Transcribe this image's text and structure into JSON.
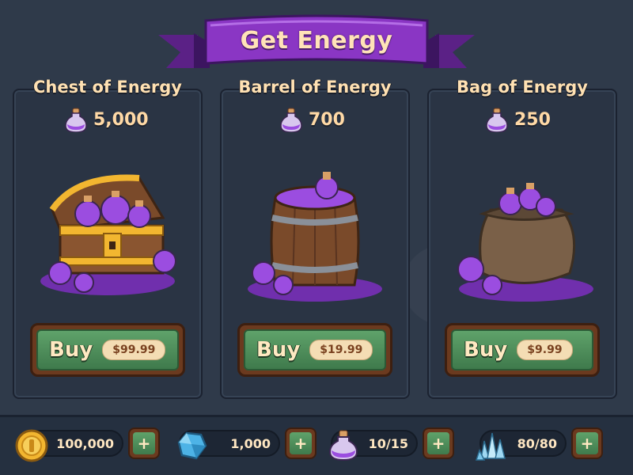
{
  "header": {
    "title": "Get Energy"
  },
  "offers": [
    {
      "title": "Chest of Energy",
      "amount": "5,000",
      "buy_label": "Buy",
      "price": "$99.99"
    },
    {
      "title": "Barrel of Energy",
      "amount": "700",
      "buy_label": "Buy",
      "price": "$19.99"
    },
    {
      "title": "Bag of Energy",
      "amount": "250",
      "buy_label": "Buy",
      "price": "$9.99"
    }
  ],
  "resources": {
    "coins": {
      "value": "100,000",
      "plus": "+"
    },
    "gems": {
      "value": "1,000",
      "plus": "+"
    },
    "energy": {
      "value": "10/15",
      "plus": "+"
    },
    "crystals": {
      "value": "80/80",
      "plus": "+"
    }
  },
  "icons": {
    "energy": "potion-icon",
    "coins": "coin-icon",
    "gems": "gem-icon",
    "crystals": "crystal-icon"
  },
  "colors": {
    "background": "#2f3a4a",
    "banner": "#7b2fb0",
    "button_green": "#4f8e5c",
    "potion": "#9b4de0",
    "title_text": "#ffe1b3"
  }
}
